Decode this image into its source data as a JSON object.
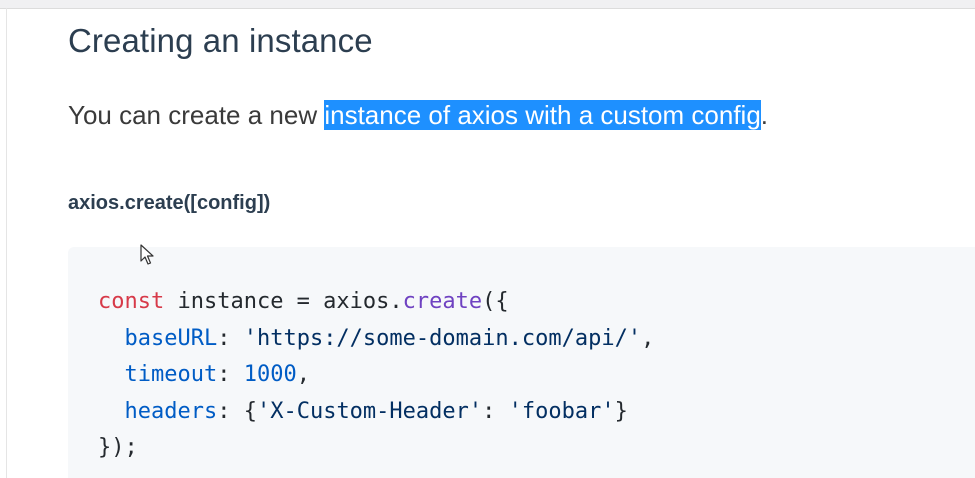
{
  "section": {
    "heading": "Creating an instance",
    "intro_before": "You can create a new ",
    "intro_highlight": "instance of axios with a custom config",
    "intro_after": ".",
    "method_signature": "axios.create([config])"
  },
  "code": {
    "line1": {
      "kw": "const",
      "text1": " instance = axios.",
      "fn": "create",
      "text2": "({"
    },
    "line2": {
      "indent": "  ",
      "prop": "baseURL",
      "sep": ": ",
      "str": "'https://some-domain.com/api/'",
      "end": ","
    },
    "line3": {
      "indent": "  ",
      "prop": "timeout",
      "sep": ": ",
      "num": "1000",
      "end": ","
    },
    "line4": {
      "indent": "  ",
      "prop": "headers",
      "sep": ": {",
      "str": "'X-Custom-Header'",
      "mid": ": ",
      "str2": "'foobar'",
      "end": "}"
    },
    "line5": {
      "text": "});"
    }
  },
  "colors": {
    "highlight": "#1e90ff",
    "code_bg": "#f6f8fa",
    "keyword": "#d73a49",
    "function": "#6f42c1",
    "property": "#005cc5",
    "string": "#032f62"
  },
  "icons": {
    "cursor": "mouse-pointer-icon"
  }
}
